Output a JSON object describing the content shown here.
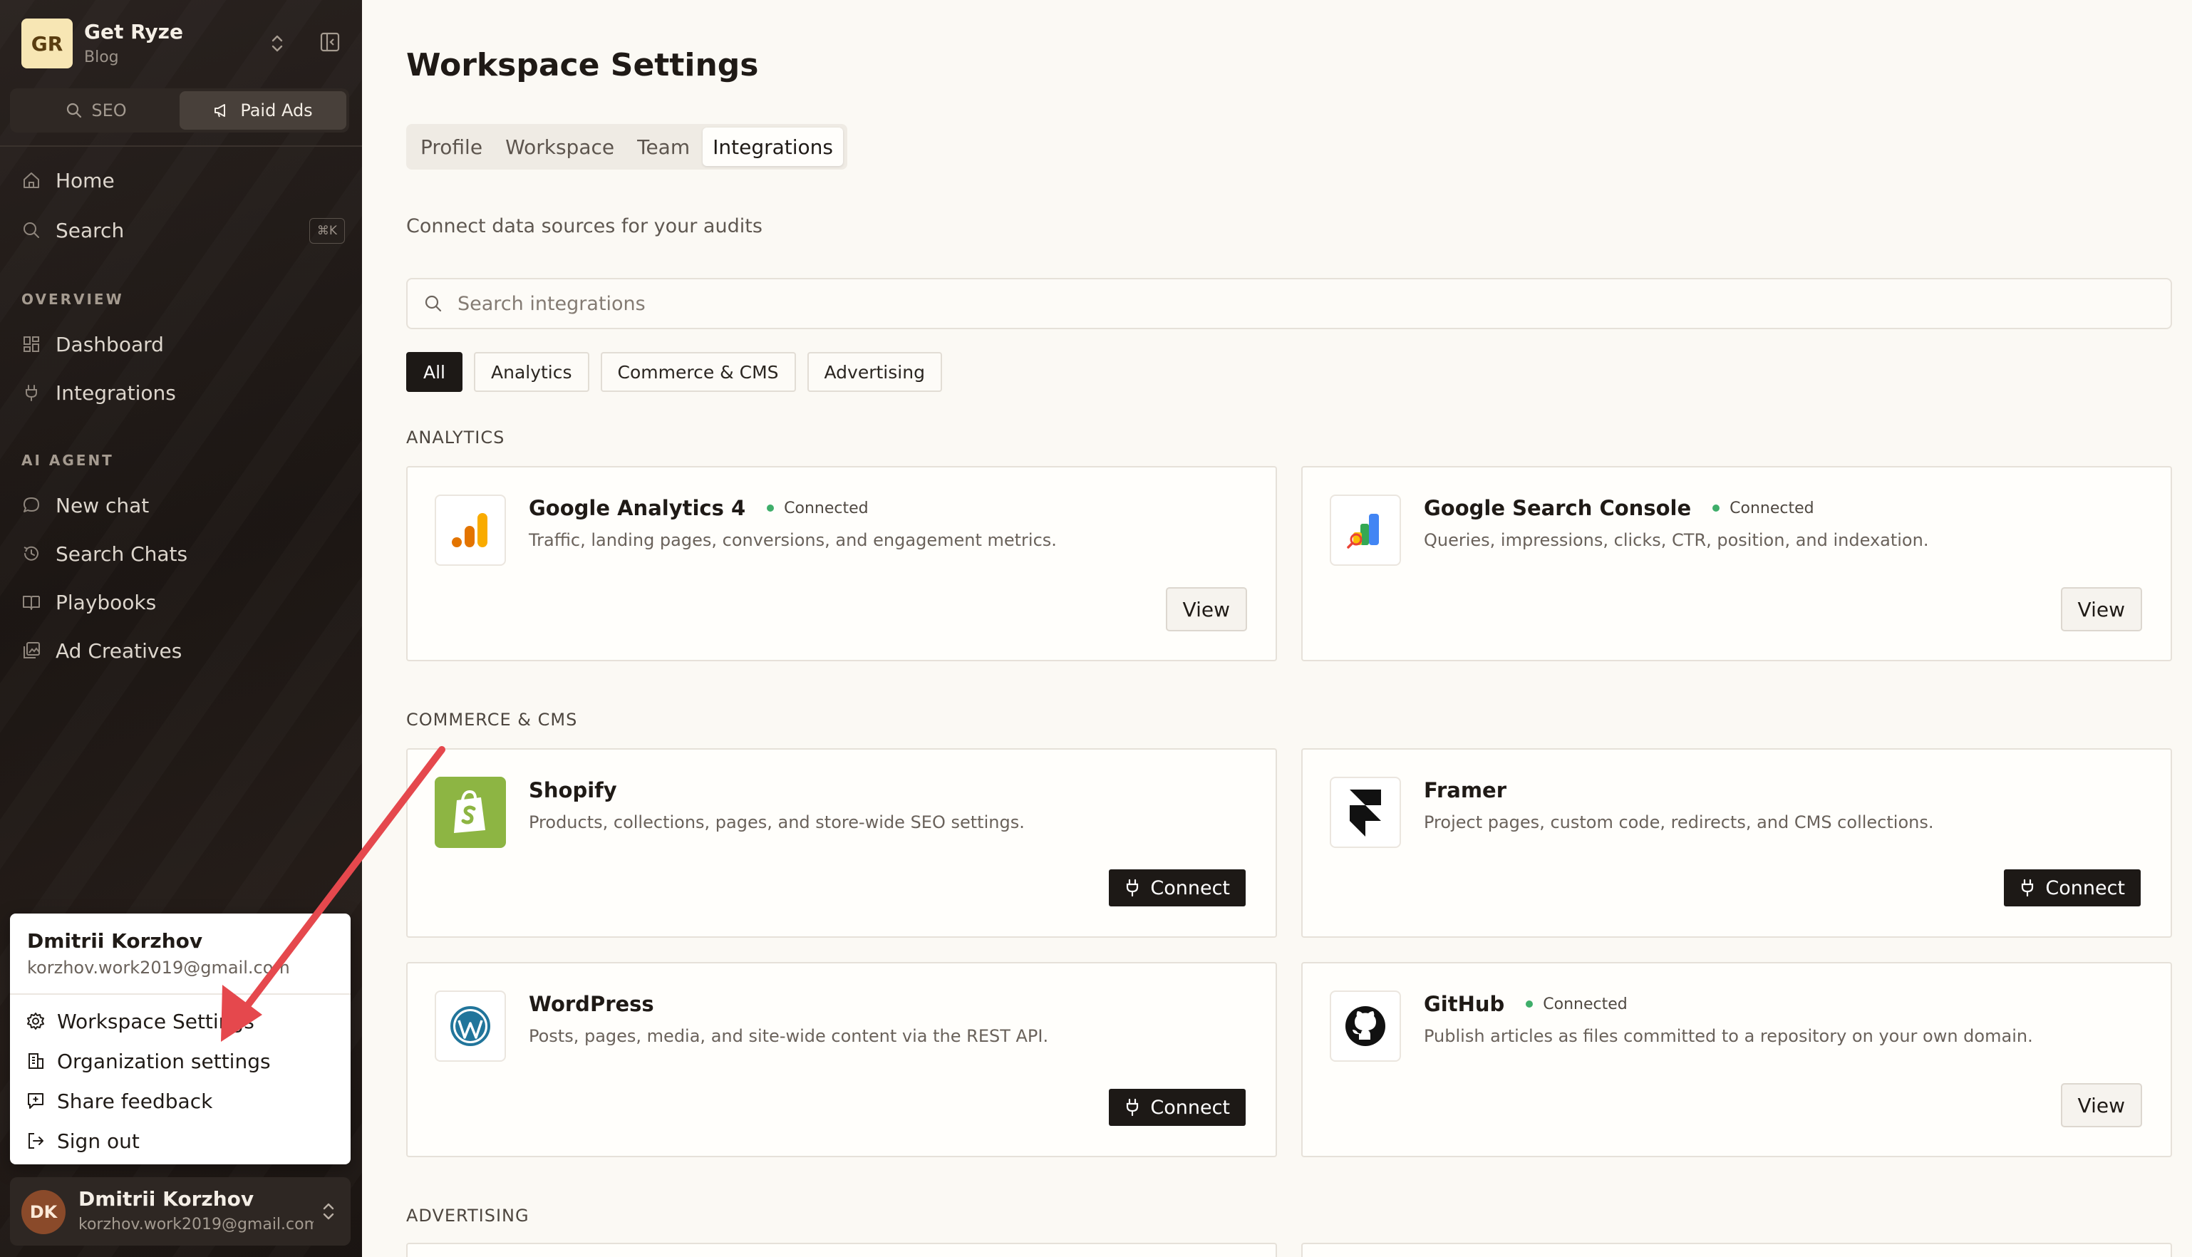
{
  "workspace": {
    "initials": "GR",
    "name": "Get Ryze",
    "sub": "Blog"
  },
  "mode_tabs": [
    {
      "label": "SEO",
      "icon": "search-icon"
    },
    {
      "label": "Paid Ads",
      "icon": "megaphone-icon"
    }
  ],
  "nav": {
    "home": "Home",
    "search": "Search",
    "search_shortcut": "⌘K",
    "overview_label": "OVERVIEW",
    "dashboard": "Dashboard",
    "integrations": "Integrations",
    "ai_agent_label": "AI AGENT",
    "new_chat": "New chat",
    "search_chats": "Search Chats",
    "playbooks": "Playbooks",
    "ad_creatives": "Ad Creatives"
  },
  "user_menu": {
    "name": "Dmitrii Korzhov",
    "email": "korzhov.work2019@gmail.com",
    "workspace_settings": "Workspace Settings",
    "organization_settings": "Organization settings",
    "share_feedback": "Share feedback",
    "sign_out": "Sign out"
  },
  "user_footer": {
    "initials": "DK",
    "name": "Dmitrii Korzhov",
    "email": "korzhov.work2019@gmail.com"
  },
  "page": {
    "title": "Workspace Settings",
    "tabs": [
      "Profile",
      "Workspace",
      "Team",
      "Integrations"
    ],
    "active_tab": "Integrations",
    "subtitle": "Connect data sources for your audits",
    "search_placeholder": "Search integrations",
    "filters": [
      "All",
      "Analytics",
      "Commerce & CMS",
      "Advertising"
    ],
    "active_filter": "All"
  },
  "sections": {
    "analytics": "ANALYTICS",
    "commerce": "COMMERCE & CMS",
    "advertising": "ADVERTISING"
  },
  "integrations": {
    "ga4": {
      "title": "Google Analytics 4",
      "status": "Connected",
      "desc": "Traffic, landing pages, conversions, and engagement metrics.",
      "action": "View"
    },
    "gsc": {
      "title": "Google Search Console",
      "status": "Connected",
      "desc": "Queries, impressions, clicks, CTR, position, and indexation.",
      "action": "View"
    },
    "shopify": {
      "title": "Shopify",
      "desc": "Products, collections, pages, and store-wide SEO settings.",
      "action": "Connect"
    },
    "framer": {
      "title": "Framer",
      "desc": "Project pages, custom code, redirects, and CMS collections.",
      "action": "Connect"
    },
    "wordpress": {
      "title": "WordPress",
      "desc": "Posts, pages, media, and site-wide content via the REST API.",
      "action": "Connect"
    },
    "github": {
      "title": "GitHub",
      "status": "Connected",
      "desc": "Publish articles as files committed to a repository on your own domain.",
      "action": "View"
    }
  },
  "colors": {
    "accent_dark": "#1d1916",
    "connected_dot": "#3fae6a",
    "annotation_arrow": "#e5484d"
  }
}
